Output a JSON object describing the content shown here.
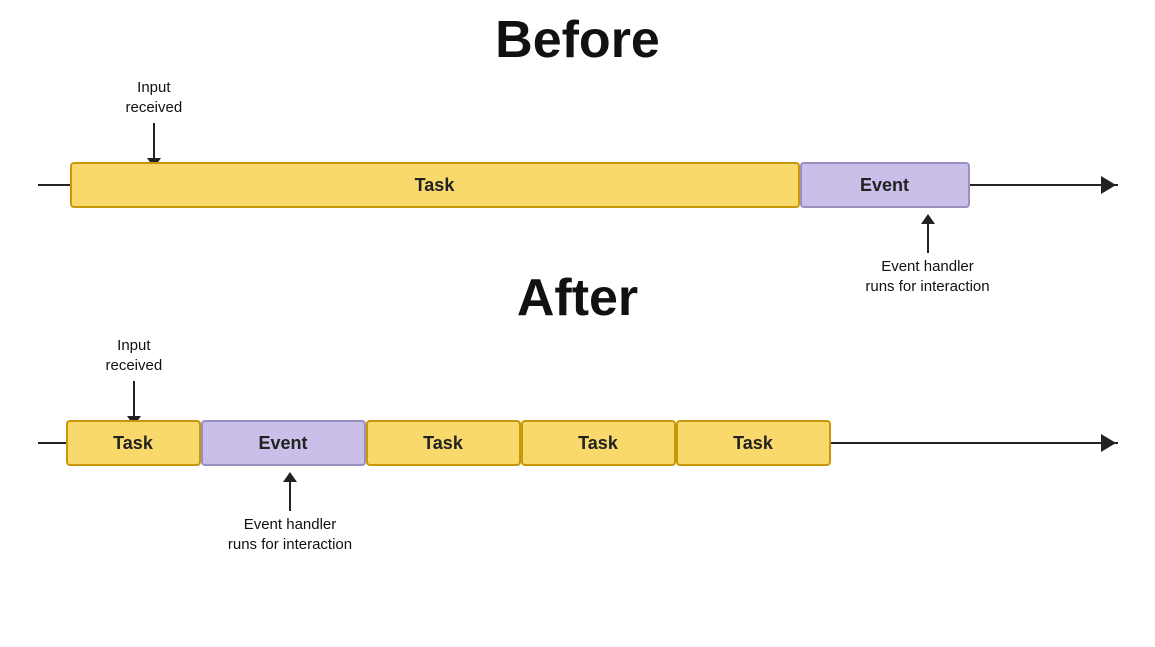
{
  "before": {
    "title": "Before",
    "input_label": "Input\nreceived",
    "task_label": "Task",
    "event_label": "Event",
    "event_annotation": "Event handler\nruns for interaction"
  },
  "after": {
    "title": "After",
    "input_label": "Input\nreceived",
    "task_label": "Task",
    "event_label": "Event",
    "event_annotation": "Event handler\nruns for interaction",
    "task2_label": "Task",
    "task3_label": "Task",
    "task4_label": "Task"
  }
}
